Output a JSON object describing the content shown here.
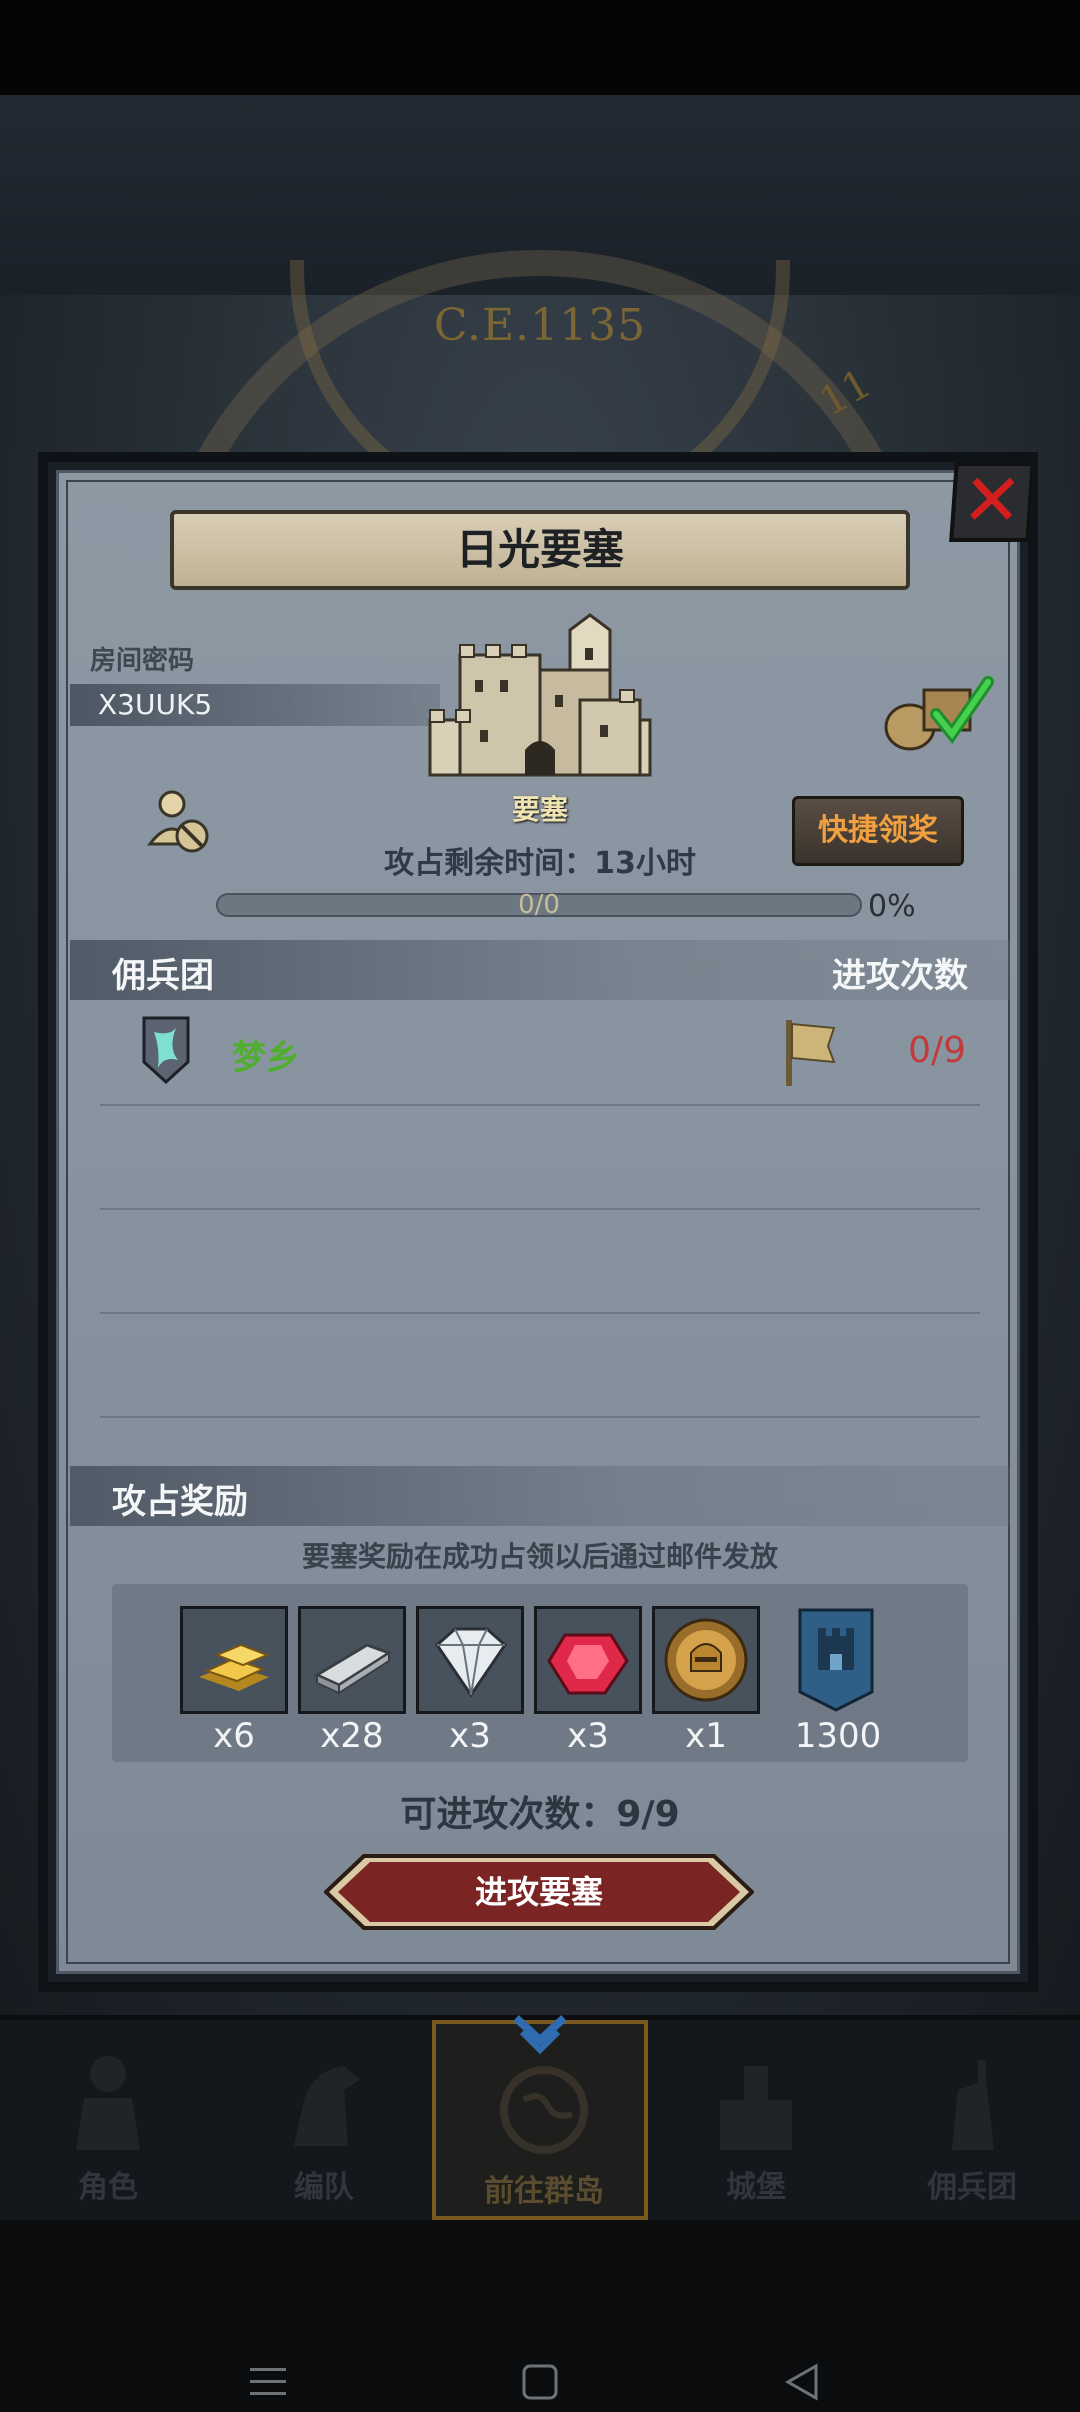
{
  "background": {
    "era_label": "C.E.1135",
    "era_mark": "11"
  },
  "dialog": {
    "title": "日光要塞",
    "close_icon": "close-x-icon",
    "room_code_label": "房间密码",
    "room_code": "X3UUK5",
    "fortress_label": "要塞",
    "quick_claim_label": "快捷领奖",
    "remaining_time": "攻占剩余时间：13小时",
    "progress_text": "0/0",
    "progress_percent_text": "0%",
    "progress_fraction": 0
  },
  "mercenary": {
    "header_left": "佣兵团",
    "header_right": "进攻次数",
    "rows": [
      {
        "name": "梦乡",
        "attacks": "0/9",
        "name_color": "#4fae2e",
        "attacks_color": "#c23b3b"
      }
    ]
  },
  "rewards": {
    "header": "攻占奖励",
    "note": "要塞奖励在成功占领以后通过邮件发放",
    "items": [
      {
        "icon": "gold-bar-icon",
        "qty": "x6"
      },
      {
        "icon": "iron-ingot-icon",
        "qty": "x28"
      },
      {
        "icon": "diamond-icon",
        "qty": "x3"
      },
      {
        "icon": "ruby-icon",
        "qty": "x3"
      },
      {
        "icon": "knight-medal-icon",
        "qty": "x1"
      },
      {
        "icon": "castle-banner-icon",
        "qty": "1300"
      }
    ]
  },
  "attack": {
    "available_text": "可进攻次数：9/9",
    "button_label": "进攻要塞"
  },
  "nav": {
    "items": [
      {
        "label": "角色",
        "icon": "knight-icon",
        "active": false
      },
      {
        "label": "编队",
        "icon": "horse-icon",
        "active": false
      },
      {
        "label": "前往群岛",
        "icon": "globe-icon",
        "active": true
      },
      {
        "label": "城堡",
        "icon": "castle-icon",
        "active": false
      },
      {
        "label": "佣兵团",
        "icon": "mercenary-icon",
        "active": false
      }
    ]
  },
  "colors": {
    "accent_gold": "#f0a040",
    "attack_red": "#7a2424",
    "panel": "#8894a0"
  }
}
